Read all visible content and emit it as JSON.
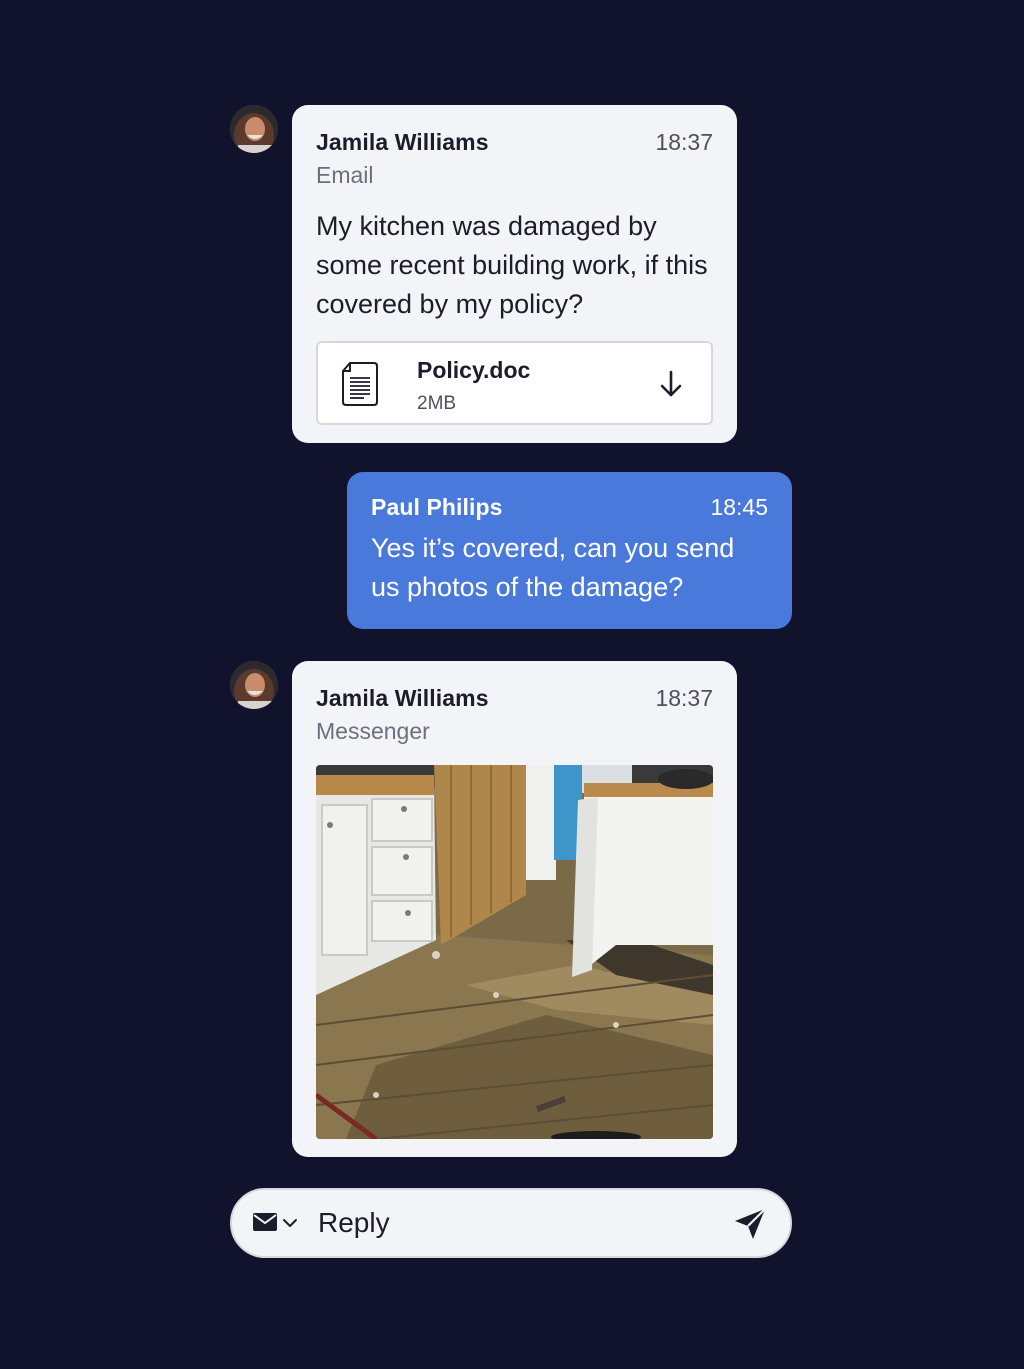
{
  "messages": [
    {
      "sender": "Jamila Williams",
      "time": "18:37",
      "channel": "Email",
      "text": "My kitchen was damaged by some recent building work, if this covered by my policy?",
      "attachment": {
        "name": "Policy.doc",
        "size": "2MB"
      }
    },
    {
      "sender": "Paul Philips",
      "time": "18:45",
      "text": "Yes it’s covered, can you send us photos of the damage?"
    },
    {
      "sender": "Jamila Williams",
      "time": "18:37",
      "channel": "Messenger",
      "image": "kitchen-damage-photo"
    }
  ],
  "composer": {
    "placeholder": "Reply",
    "channel_icon": "envelope-icon",
    "send_icon": "send-icon"
  },
  "colors": {
    "background": "#10132b",
    "incoming_bubble": "#f3f4f7",
    "outgoing_bubble": "#4a79dc"
  }
}
